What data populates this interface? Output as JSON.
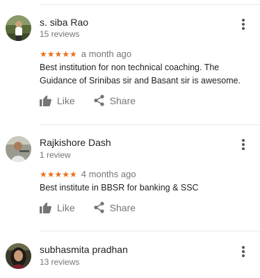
{
  "reviews": [
    {
      "reviewer_name": "s. siba Rao",
      "review_count": "15 reviews",
      "stars": "★★★★★",
      "time": "a month ago",
      "text": "Best institution for non technical coaching. The Guidance of Srinibas sir and Basant sir is awesome.",
      "like_label": "Like",
      "share_label": "Share"
    },
    {
      "reviewer_name": "Rajkishore Dash",
      "review_count": "1 review",
      "stars": "★★★★★",
      "time": "4 months ago",
      "text": "Best institute in BBSR for banking & SSC",
      "like_label": "Like",
      "share_label": "Share"
    },
    {
      "reviewer_name": "subhasmita pradhan",
      "review_count": "13 reviews"
    }
  ],
  "colors": {
    "star": "#e7711b",
    "icon": "#757575",
    "text": "#222222",
    "secondary_text": "#757575",
    "divider": "#e8e8e8"
  },
  "icons": {
    "more": "more-vert-icon",
    "like": "thumb-up-icon",
    "share": "share-icon"
  }
}
